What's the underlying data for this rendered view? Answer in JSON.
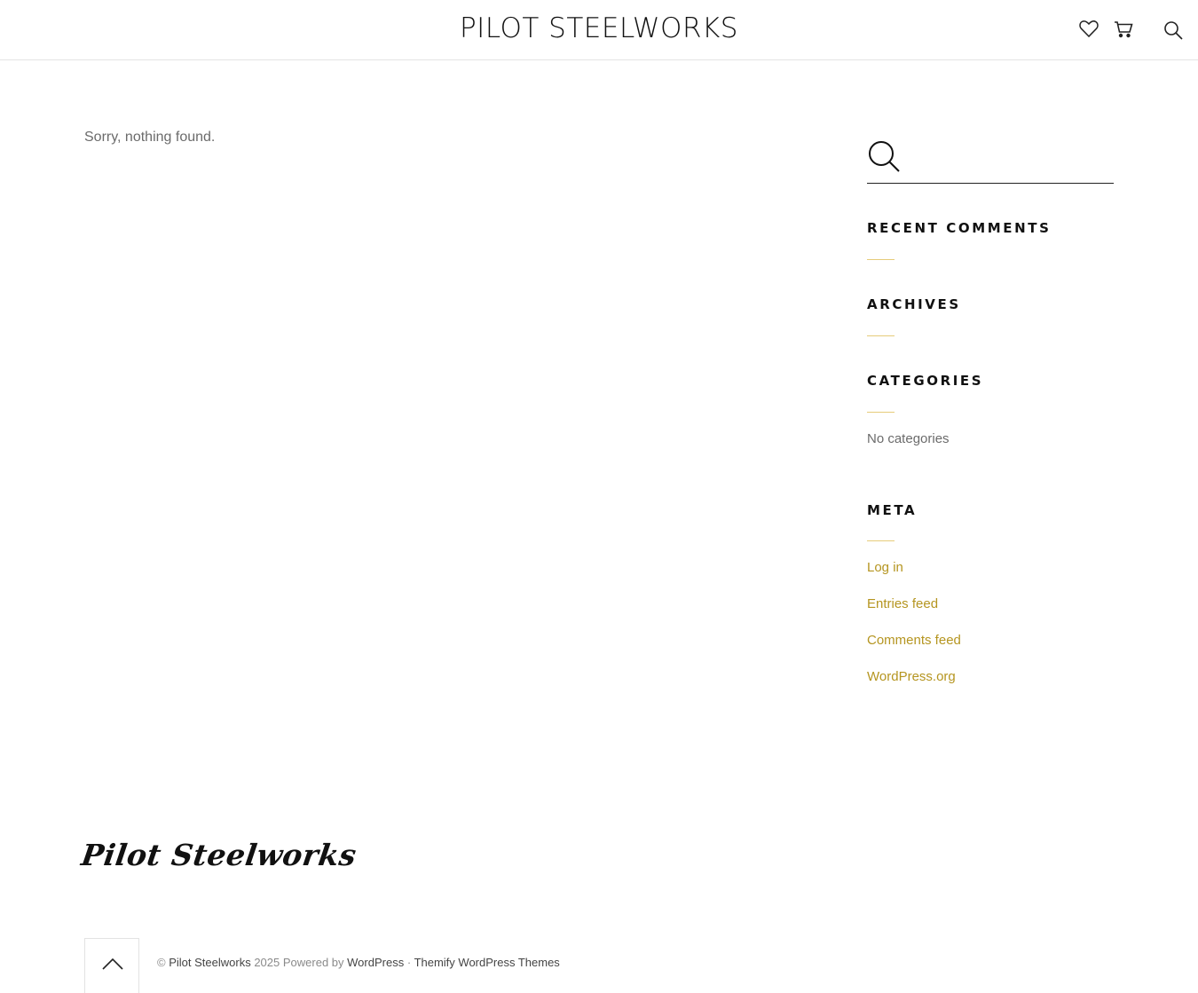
{
  "header": {
    "site_title": "PILOT STEELWORKS",
    "icons": [
      "heart-icon",
      "cart-icon",
      "search-icon"
    ]
  },
  "main": {
    "message": "Sorry, nothing found."
  },
  "sidebar": {
    "search": {
      "value": "",
      "placeholder": ""
    },
    "recent_comments_title": "RECENT COMMENTS",
    "archives_title": "ARCHIVES",
    "categories_title": "CATEGORIES",
    "categories_empty": "No categories",
    "meta_title": "META",
    "meta_links": [
      "Log in",
      "Entries feed",
      "Comments feed",
      "WordPress.org"
    ]
  },
  "footer": {
    "logo_text": "Pilot Steelworks",
    "copyright_symbol": "©",
    "site_link": "Pilot Steelworks",
    "year_text": "2025 Powered by",
    "wordpress_link": "WordPress",
    "separator": "·",
    "themify_link": "Themify WordPress Themes"
  },
  "colors": {
    "link_gold": "#b59520",
    "accent_rule": "#e6cc7a",
    "text_dark": "#111111",
    "text_muted": "#6b6b6b"
  }
}
